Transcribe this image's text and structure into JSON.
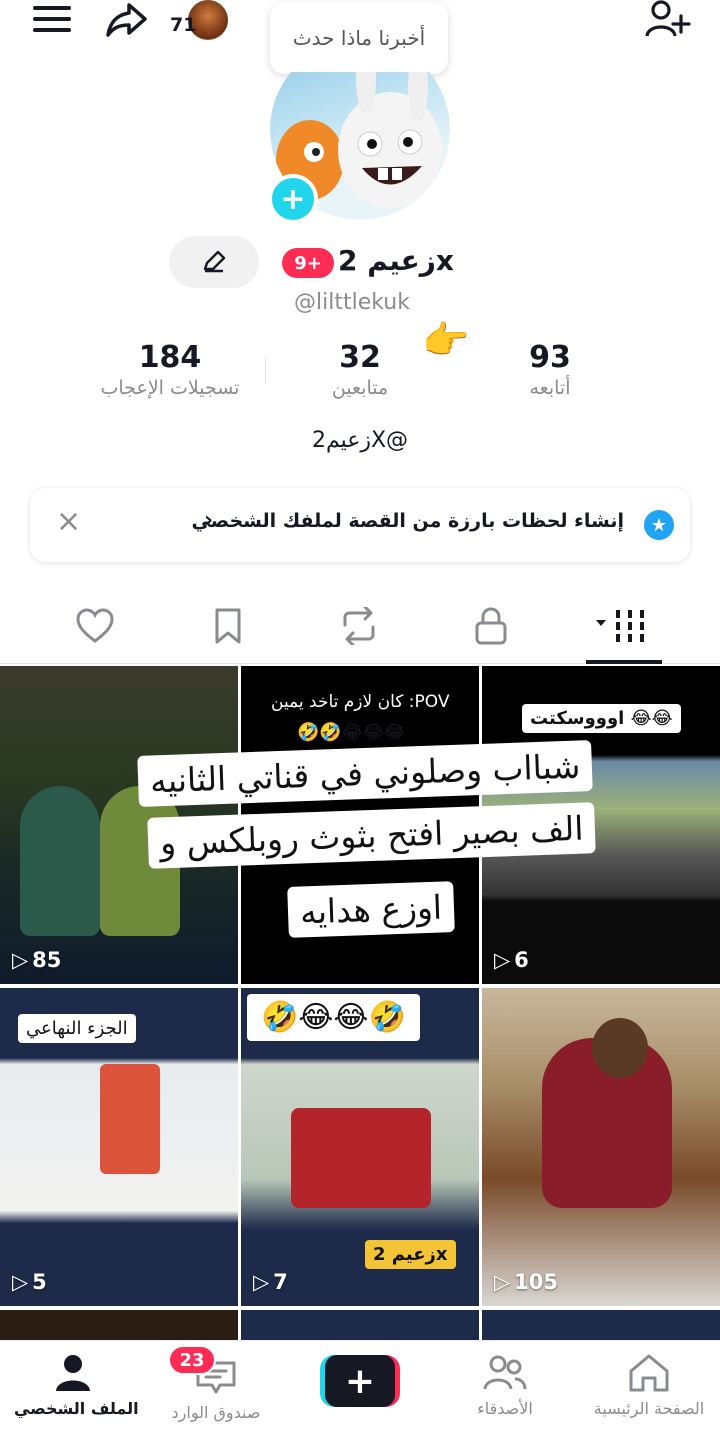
{
  "top_bar": {
    "story_count": "71",
    "notification_bubble": "أخبرنا ماذا حدث"
  },
  "profile": {
    "display_name": "زعيم 2x",
    "badge": "9+",
    "username": "@lilttlekuk",
    "bio": "زعيم2X@",
    "stats": {
      "likes": {
        "value": "184",
        "label": "تسجيلات الإعجاب"
      },
      "followers": {
        "value": "32",
        "label": "متابعين"
      },
      "following": {
        "value": "93",
        "label": "أتابعه"
      }
    }
  },
  "highlights": {
    "text": "إنشاء لحظات بارزة من القصة لملفك الشخصي",
    "chevron": "›",
    "close": "×"
  },
  "tabs": [
    "videos-tab",
    "private-tab",
    "reposts-tab",
    "favorites-tab",
    "liked-tab"
  ],
  "videos": [
    {
      "count": "6",
      "caption": "اوووسكتت 😂😂"
    },
    {
      "count": "",
      "caption": "كان لازم تاخد يمين :POV",
      "sub": "🤣🤣😂😂😂"
    },
    {
      "count": "85",
      "caption": ""
    },
    {
      "count": "105",
      "caption": ""
    },
    {
      "count": "7",
      "caption": "🤣😂😂🤣",
      "tag": "زعيم 2x"
    },
    {
      "count": "5",
      "caption": "الجزء النهاعي"
    }
  ],
  "overlay_note": {
    "line1": "شبااب وصلوني في قناتي الثانيه",
    "line2": "الف بصير افتح بثوث روبلكس و",
    "line3": "اوزع هدايه"
  },
  "bottom_nav": {
    "home": "الصفحة الرئيسية",
    "friends": "الأصدقاء",
    "inbox": "صندوق الوارد",
    "inbox_badge": "23",
    "profile": "الملف الشخصي"
  },
  "colors": {
    "accent_red": "#fe2c55",
    "accent_cyan": "#20d5ec",
    "text_primary": "#161823",
    "text_secondary": "#8a8b91"
  }
}
